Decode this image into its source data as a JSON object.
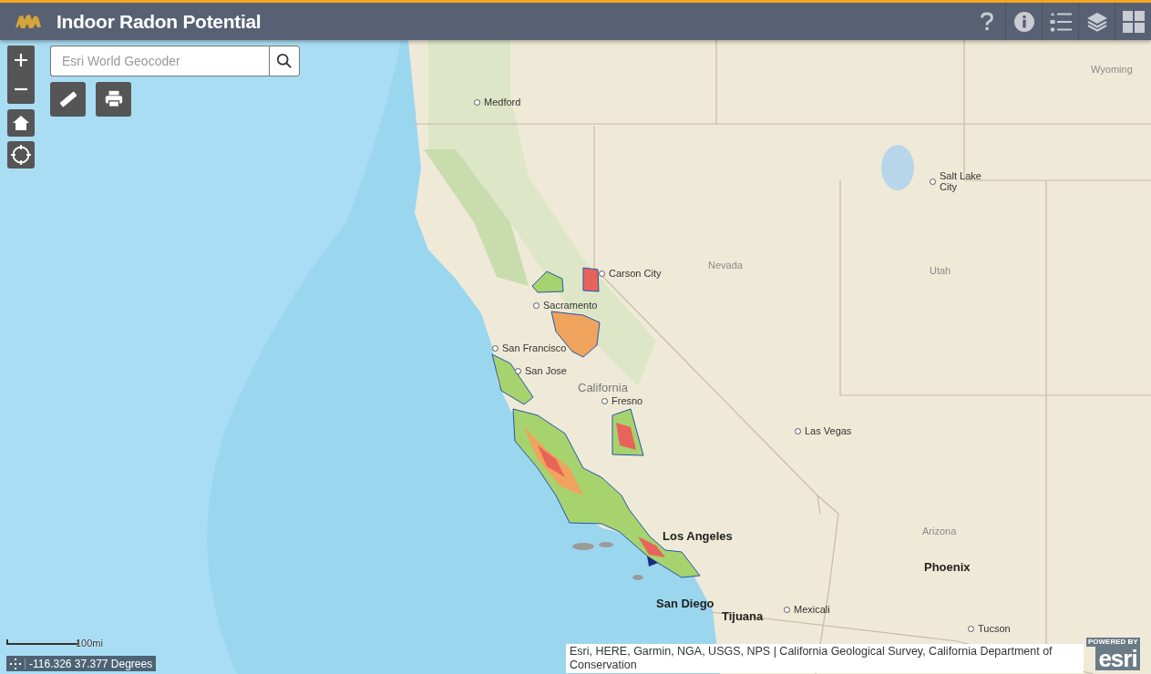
{
  "header": {
    "title": "Indoor Radon Potential"
  },
  "search": {
    "placeholder": "Esri World Geocoder"
  },
  "map": {
    "labels": [
      {
        "text": "Medford",
        "kind": "town"
      },
      {
        "text": "Wyoming",
        "kind": "region"
      },
      {
        "text": "Salt Lake City",
        "kind": "city"
      },
      {
        "text": "Carson City",
        "kind": "town"
      },
      {
        "text": "Nevada",
        "kind": "region"
      },
      {
        "text": "Sacramento",
        "kind": "town"
      },
      {
        "text": "San Francisco",
        "kind": "town"
      },
      {
        "text": "San Jose",
        "kind": "town"
      },
      {
        "text": "California",
        "kind": "state"
      },
      {
        "text": "Fresno",
        "kind": "town"
      },
      {
        "text": "Utah",
        "kind": "region"
      },
      {
        "text": "Las Vegas",
        "kind": "town"
      },
      {
        "text": "Los Angeles",
        "kind": "big"
      },
      {
        "text": "Arizona",
        "kind": "region"
      },
      {
        "text": "Phoenix",
        "kind": "big"
      },
      {
        "text": "San Diego",
        "kind": "big"
      },
      {
        "text": "Tijuana",
        "kind": "big"
      },
      {
        "text": "Mexicali",
        "kind": "town"
      },
      {
        "text": "Tucson",
        "kind": "town"
      }
    ]
  },
  "scale": {
    "label": "100mi"
  },
  "coordinates": {
    "text": "-116.326 37.377 Degrees"
  },
  "attribution": {
    "text": "Esri, HERE, Garmin, NGA, USGS, NPS | California Geological Survey, California Department of Conservation"
  },
  "logo": {
    "caption": "POWERED BY",
    "brand": "esri"
  }
}
